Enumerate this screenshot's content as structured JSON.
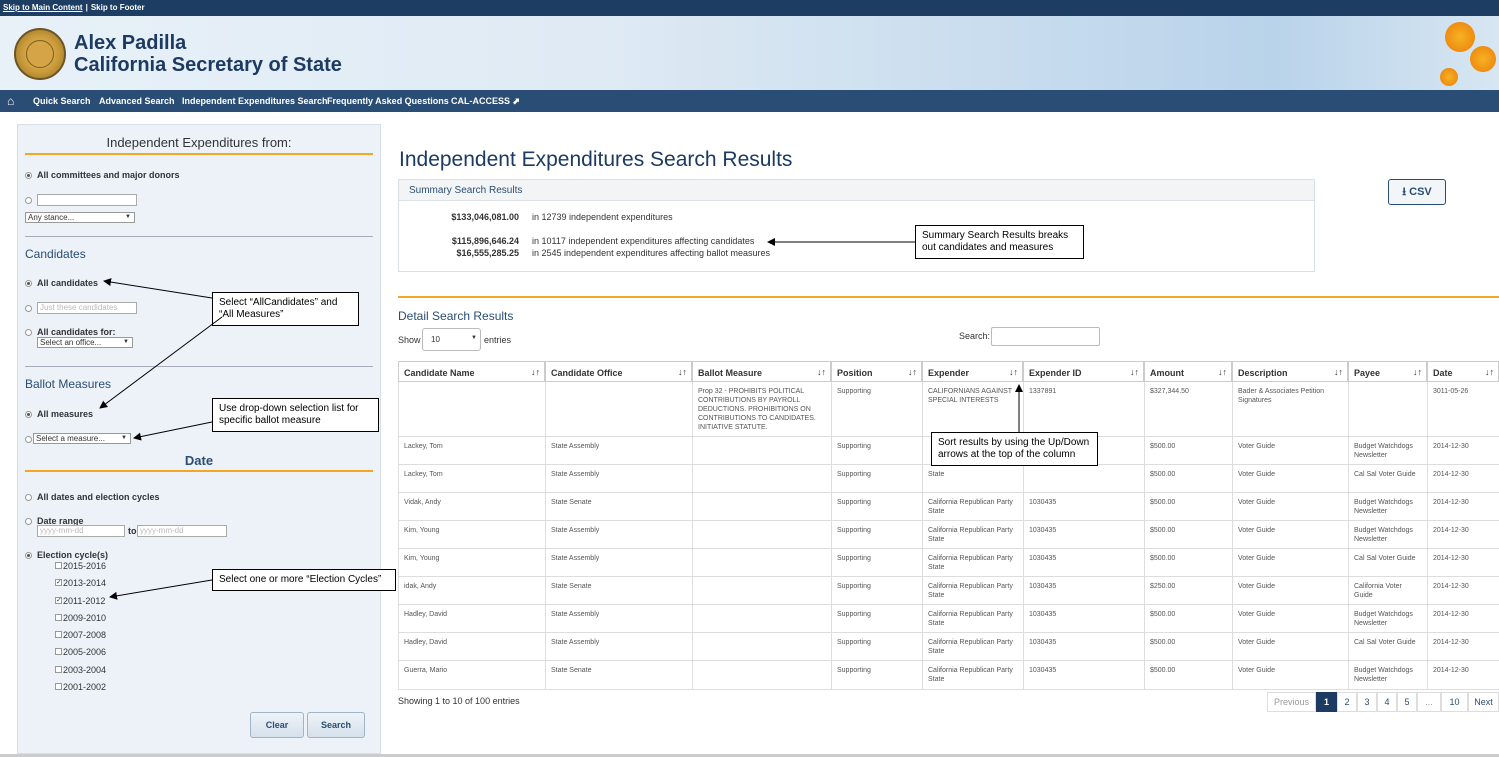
{
  "skip": {
    "main": "Skip to Main Content",
    "sep": "|",
    "footer": "Skip to Footer"
  },
  "header": {
    "name": "Alex Padilla",
    "office": "California Secretary of State"
  },
  "nav": {
    "items": [
      "Quick Search",
      "Advanced Search",
      "Independent Expenditures Search",
      "Frequently Asked Questions",
      "CAL-ACCESS ⬈"
    ]
  },
  "sidebar": {
    "title": "Independent Expenditures from:",
    "all_committees": "All committees and major donors",
    "stance_select": "Any stance...",
    "candidates_title": "Candidates",
    "all_candidates": "All candidates",
    "just_these_placeholder": "Just these candidates",
    "all_candidates_for": "All candidates for:",
    "office_select": "Select an office...",
    "ballot_title": "Ballot Measures",
    "all_measures": "All measures",
    "measure_select": "Select a measure...",
    "date_title": "Date",
    "all_dates": "All dates and election cycles",
    "date_range": "Date range",
    "date_from_placeholder": "yyyy-mm-dd",
    "date_to": "to",
    "date_to_placeholder": "yyyy-mm-dd",
    "cycles_label": "Election cycle(s)",
    "cycles": [
      {
        "label": "2015-2016",
        "checked": false
      },
      {
        "label": "2013-2014",
        "checked": true
      },
      {
        "label": "2011-2012",
        "checked": true
      },
      {
        "label": "2009-2010",
        "checked": false
      },
      {
        "label": "2007-2008",
        "checked": false
      },
      {
        "label": "2005-2006",
        "checked": false
      },
      {
        "label": "2003-2004",
        "checked": false
      },
      {
        "label": "2001-2002",
        "checked": false
      }
    ],
    "clear": "Clear",
    "search": "Search"
  },
  "main": {
    "title": "Independent Expenditures Search Results",
    "csv": "⭳ CSV",
    "summary_title": "Summary Search Results",
    "summary": [
      {
        "amount": "$133,046,081.00",
        "text": "in 12739 independent expenditures"
      },
      {
        "amount": "$115,896,646.24",
        "text": "in 10117 independent expenditures affecting candidates"
      },
      {
        "amount": "$16,555,285.25",
        "text": "in 2545 independent expenditures affecting ballot measures"
      }
    ],
    "detail_title": "Detail Search Results",
    "show": "Show",
    "entries_value": "10",
    "entries": "entries",
    "search_label": "Search:",
    "columns": [
      "Candidate Name",
      "Candidate Office",
      "Ballot Measure",
      "Position",
      "Expender",
      "Expender ID",
      "Amount",
      "Description",
      "Payee",
      "Date"
    ],
    "rows": [
      [
        "",
        "",
        "Prop 32 - PROHIBITS POLITICAL CONTRIBUTIONS BY PAYROLL DEDUCTIONS. PROHIBITIONS ON CONTRIBUTIONS TO CANDIDATES. INITIATIVE STATUTE.",
        "Supporting",
        "CALIFORNIANS AGAINST SPECIAL INTERESTS",
        "1337891",
        "$327,344.50",
        "Bader & Associates Petition Signatures",
        "",
        "3011-05-26"
      ],
      [
        "Lackey, Tom",
        "State Assembly",
        "",
        "Supporting",
        "",
        "",
        "$500.00",
        "Voter Guide",
        "Budget Watchdogs Newsletter",
        "2014-12-30"
      ],
      [
        "Lackey, Tom",
        "State Assembly",
        "",
        "Supporting",
        "State",
        "",
        "$500.00",
        "Voter Guide",
        "Cal Sal Voter Guide",
        "2014-12-30"
      ],
      [
        "Vidak, Andy",
        "State Senate",
        "",
        "Supporting",
        "California Republican Party State",
        "1030435",
        "$500.00",
        "Voter Guide",
        "Budget Watchdogs Newsletter",
        "2014-12-30"
      ],
      [
        "Kim, Young",
        "State Assembly",
        "",
        "Supporting",
        "California Republican Party State",
        "1030435",
        "$500.00",
        "Voter Guide",
        "Budget Watchdogs Newsletter",
        "2014-12-30"
      ],
      [
        "Kim, Young",
        "State Assembly",
        "",
        "Supporting",
        "California Republican Party State",
        "1030435",
        "$500.00",
        "Voter Guide",
        "Cal Sal Voter Guide",
        "2014-12-30"
      ],
      [
        "idak, Andy",
        "State Senate",
        "",
        "Supporting",
        "California Republican Party State",
        "1030435",
        "$250.00",
        "Voter Guide",
        "California Voter Guide",
        "2014-12-30"
      ],
      [
        "Hadley, David",
        "State Assembly",
        "",
        "Supporting",
        "California Republican Party State",
        "1030435",
        "$500.00",
        "Voter Guide",
        "Budget Watchdogs Newsletter",
        "2014-12-30"
      ],
      [
        "Hadley, David",
        "State Assembly",
        "",
        "Supporting",
        "California Republican Party State",
        "1030435",
        "$500.00",
        "Voter Guide",
        "Cal Sal Voter Guide",
        "2014-12-30"
      ],
      [
        "Guerra, Mario",
        "State Senate",
        "",
        "Supporting",
        "California Republican Party State",
        "1030435",
        "$500.00",
        "Voter Guide",
        "Budget Watchdogs Newsletter",
        "2014-12-30"
      ]
    ],
    "showing": "Showing 1 to 10 of 100 entries",
    "pager": [
      "Previous",
      "1",
      "2",
      "3",
      "4",
      "5",
      "...",
      "10",
      "Next"
    ]
  },
  "callouts": {
    "summary": "Summary Search Results breaks out candidates and measures",
    "select_all": "Select “AllCandidates” and “All Measures”",
    "dropdown": "Use drop-down selection list for specific ballot measure",
    "sort": "Sort results by using the Up/Down arrows at the top of the column",
    "cycles": "Select one or more “Election Cycles”"
  },
  "colors": {
    "navy": "#1d3d63",
    "nav": "#2a4d75",
    "accent": "#f5a623"
  }
}
